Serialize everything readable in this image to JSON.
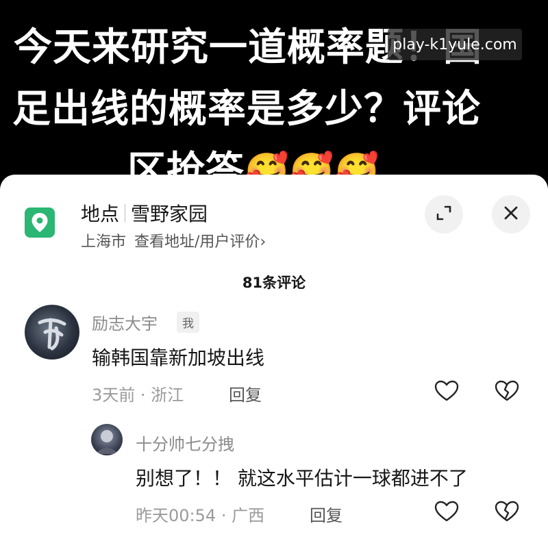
{
  "video": {
    "caption_line1": "今天来研究一道概率题！国",
    "caption_line2": "足出线的概率是多少？评论",
    "caption_line3": "区抢答",
    "emojis": "🥰🥰🥰",
    "watermark": "play-k1yule.com"
  },
  "location": {
    "label": "地点",
    "name": "雪野家园",
    "city": "上海市",
    "link": "查看地址/用户评价",
    "chevron": "›",
    "icon": "map-pin-icon",
    "accent_color": "#2bb673"
  },
  "comments_header": {
    "count_text": "81条评论"
  },
  "comments": [
    {
      "user": "励志大宇",
      "badge": "我",
      "text": "输韩国靠新加坡出线",
      "time": "3天前",
      "dot": "·",
      "region": "浙江",
      "reply_label": "回复"
    },
    {
      "user": "十分帅七分拽",
      "text": "别想了！！ 就这水平估计一球都进不了",
      "time": "昨天00:54",
      "dot": "·",
      "region": "广西",
      "reply_label": "回复"
    }
  ]
}
